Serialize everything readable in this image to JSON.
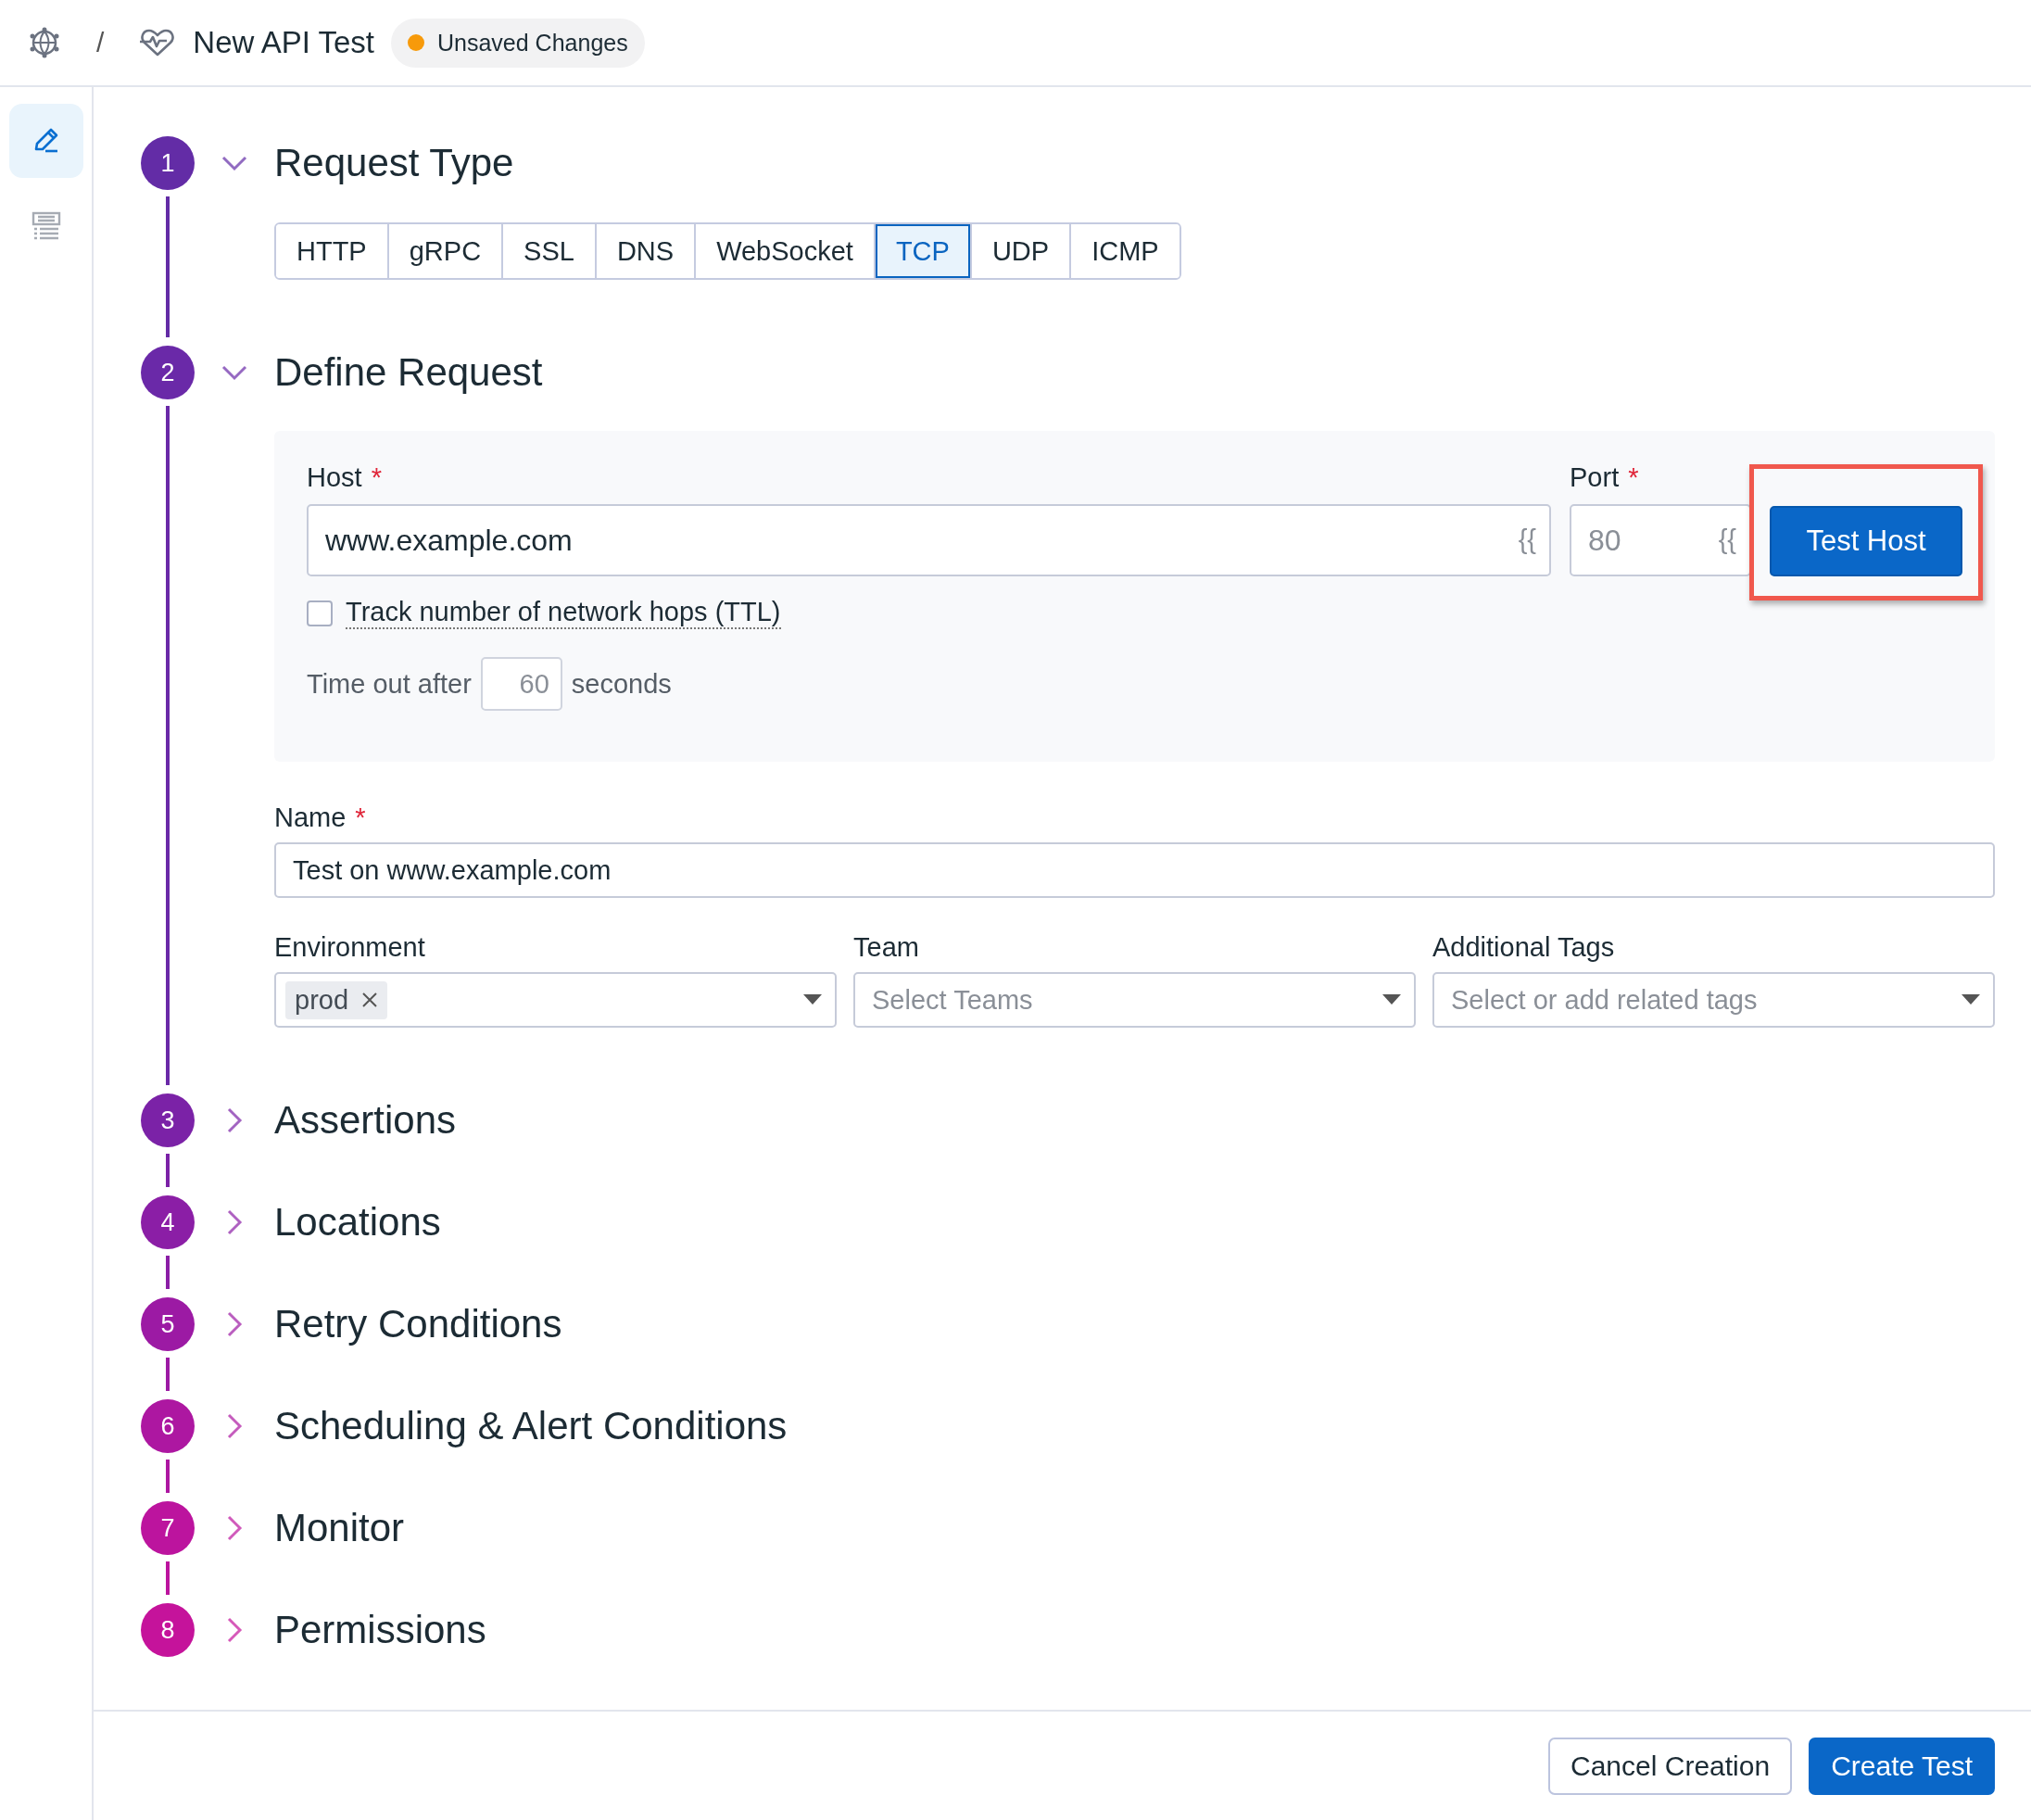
{
  "header": {
    "separator": "/",
    "title": "New API Test",
    "badge": "Unsaved Changes"
  },
  "rail": [
    {
      "kind": "edit",
      "selected": true
    },
    {
      "kind": "list",
      "selected": false
    }
  ],
  "steps": [
    {
      "number": "1",
      "title": "Request Type",
      "expanded": true,
      "color": "#632ca6",
      "request_types": [
        {
          "label": "HTTP",
          "selected": false
        },
        {
          "label": "gRPC",
          "selected": false
        },
        {
          "label": "SSL",
          "selected": false
        },
        {
          "label": "DNS",
          "selected": false
        },
        {
          "label": "WebSocket",
          "selected": false
        },
        {
          "label": "TCP",
          "selected": true
        },
        {
          "label": "UDP",
          "selected": false
        },
        {
          "label": "ICMP",
          "selected": false
        }
      ]
    },
    {
      "number": "2",
      "title": "Define Request",
      "expanded": true,
      "color": "#6a29a8",
      "request": {
        "host": {
          "label": "Host",
          "required": "*",
          "value": "www.example.com",
          "suffix": "{{"
        },
        "port": {
          "label": "Port",
          "required": "*",
          "placeholder": "80",
          "suffix": "{{"
        },
        "test_button": {
          "label": "Test Host",
          "highlighted": true
        },
        "ttl": {
          "label": "Track number of network hops (TTL)",
          "checked": false
        },
        "timeout": {
          "prefix": "Time out after",
          "placeholder": "60",
          "suffix": "seconds"
        },
        "name": {
          "label": "Name",
          "required": "*",
          "value": "Test on www.example.com"
        },
        "environment": {
          "label": "Environment",
          "tags": [
            "prod"
          ]
        },
        "team": {
          "label": "Team",
          "placeholder": "Select Teams"
        },
        "tags": {
          "label": "Additional Tags",
          "placeholder": "Select or add related tags"
        }
      }
    },
    {
      "number": "3",
      "title": "Assertions",
      "expanded": false,
      "color": "#7b22a7"
    },
    {
      "number": "4",
      "title": "Locations",
      "expanded": false,
      "color": "#8b1ea6"
    },
    {
      "number": "5",
      "title": "Retry Conditions",
      "expanded": false,
      "color": "#9c1aa4"
    },
    {
      "number": "6",
      "title": "Scheduling & Alert Conditions",
      "expanded": false,
      "color": "#ad17a1"
    },
    {
      "number": "7",
      "title": "Monitor",
      "expanded": false,
      "color": "#bc149e"
    },
    {
      "number": "8",
      "title": "Permissions",
      "expanded": false,
      "color": "#c5139b"
    }
  ],
  "footer": {
    "buttons": [
      {
        "label": "Cancel Creation",
        "kind": "secondary"
      },
      {
        "label": "Create Test",
        "kind": "primary"
      }
    ]
  }
}
